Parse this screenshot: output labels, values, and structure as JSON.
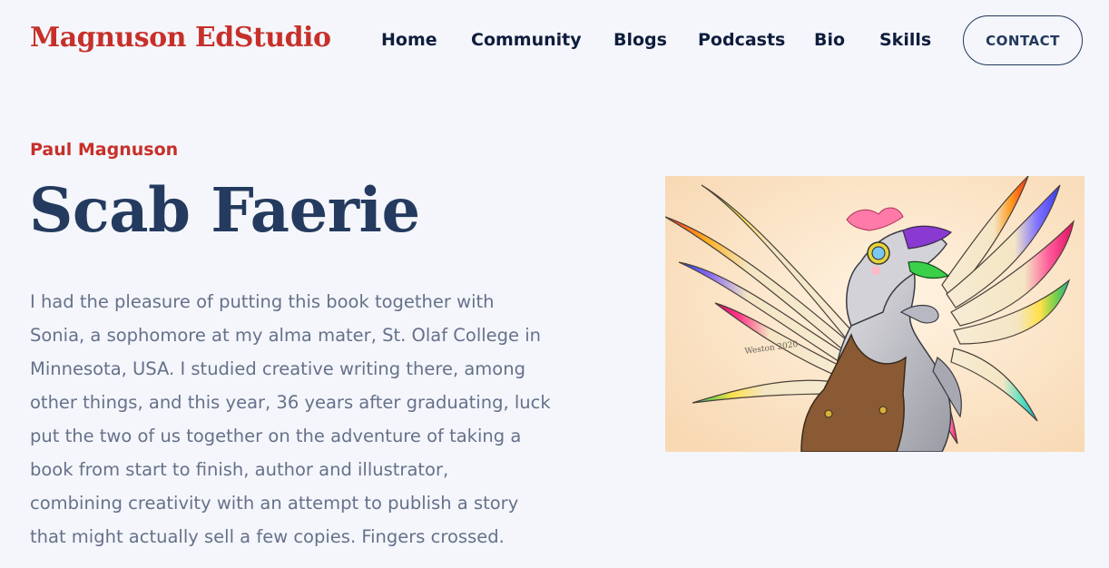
{
  "header": {
    "logo": "Magnuson EdStudio",
    "nav": [
      "Home",
      "Community",
      "Blogs",
      "Podcasts",
      "Bio",
      "Skills"
    ],
    "contact_label": "CONTACT"
  },
  "hero": {
    "author": "Paul Magnuson",
    "title": "Scab Faerie",
    "body_lines": [
      "I had the pleasure of putting this book together with",
      "Sonia, a sophomore at my alma mater, St. Olaf College in",
      "Minnesota, USA. I studied creative writing there, among",
      "other things, and this year, 36 years after graduating, luck",
      "put the two of us together on the adventure of taking a",
      "book from start to finish, author and illustrator,",
      "combining creativity with an attempt to publish a story",
      "that might actually sell a few copies. Fingers crossed."
    ],
    "art_signature": "Weston 2020"
  },
  "colors": {
    "brand_red": "#c7302a",
    "navy": "#243a5f",
    "nav_text": "#0f1d3d",
    "body_text": "#66718a",
    "background": "#f4f6fb"
  }
}
